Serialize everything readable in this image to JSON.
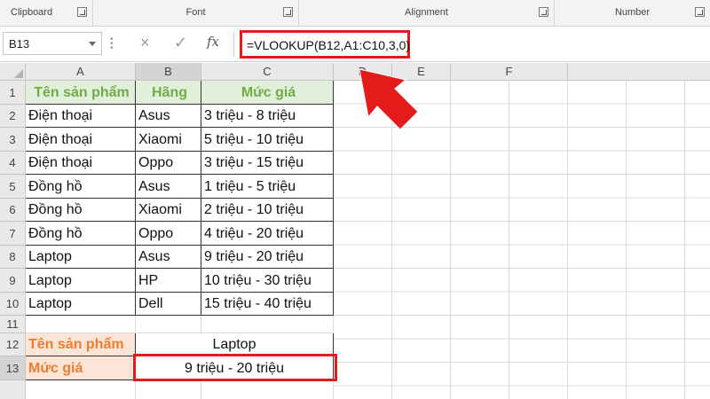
{
  "ribbon": {
    "groups": [
      "Clipboard",
      "Font",
      "Alignment",
      "Number"
    ]
  },
  "formula_bar": {
    "name_box": "B13",
    "cancel_icon": "×",
    "enter_icon": "✓",
    "fx_label": "fx",
    "formula": "=VLOOKUP(B12,A1:C10,3,0)"
  },
  "columns": [
    "A",
    "B",
    "C",
    "D",
    "E",
    "F"
  ],
  "rows": [
    "1",
    "2",
    "3",
    "4",
    "5",
    "6",
    "7",
    "8",
    "9",
    "10",
    "11",
    "12",
    "13"
  ],
  "table": {
    "headers": [
      "Tên sản phẩm",
      "Hãng",
      "Mức giá"
    ],
    "data": [
      [
        "Điện thoại",
        "Asus",
        "3 triệu - 8 triệu"
      ],
      [
        "Điện thoại",
        "Xiaomi",
        "5 triệu - 10 triệu"
      ],
      [
        "Điện thoại",
        "Oppo",
        "3 triệu - 15 triệu"
      ],
      [
        "Đồng hồ",
        "Asus",
        "1 triệu - 5 triệu"
      ],
      [
        "Đồng hồ",
        "Xiaomi",
        "2 triệu - 10 triệu"
      ],
      [
        "Đồng hồ",
        "Oppo",
        "4 triệu - 20 triệu"
      ],
      [
        "Laptop",
        "Asus",
        "9 triệu - 20 triệu"
      ],
      [
        "Laptop",
        "HP",
        "10 triệu - 30 triệu"
      ],
      [
        "Laptop",
        "Dell",
        "15 triệu - 40 triệu"
      ]
    ]
  },
  "lookup": {
    "label_product": "Tên sản phẩm",
    "value_product": "Laptop",
    "label_price": "Mức giá",
    "value_price": "9 triệu - 20 triệu"
  },
  "colors": {
    "header_green": "#70ad47",
    "label_orange": "#ed7d31",
    "highlight_red": "#e31b1b"
  }
}
